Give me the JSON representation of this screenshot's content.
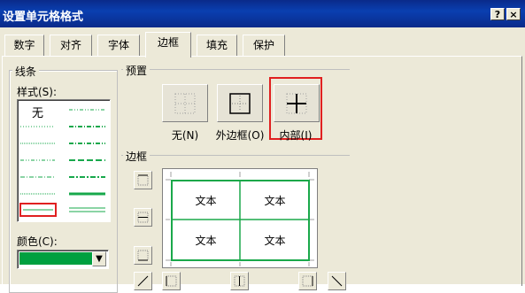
{
  "window": {
    "title": "设置单元格格式",
    "help_label": "?",
    "close_label": "×"
  },
  "tabs": [
    {
      "label": "数字"
    },
    {
      "label": "对齐"
    },
    {
      "label": "字体"
    },
    {
      "label": "边框"
    },
    {
      "label": "填充"
    },
    {
      "label": "保护"
    }
  ],
  "active_tab": "边框",
  "line": {
    "group_label": "线条",
    "style_label": "样式(S):",
    "none_label": "无",
    "color_label": "颜色(C):",
    "selected_color": "#00a040"
  },
  "presets": {
    "group_label": "预置",
    "none_label": "无(N)",
    "outline_label": "外边框(O)",
    "inside_label": "内部(I)"
  },
  "border": {
    "group_label": "边框",
    "preview_cells": [
      "文本",
      "文本",
      "文本",
      "文本"
    ],
    "line_color": "#1aa84a",
    "highlight_color": "#e02020"
  }
}
